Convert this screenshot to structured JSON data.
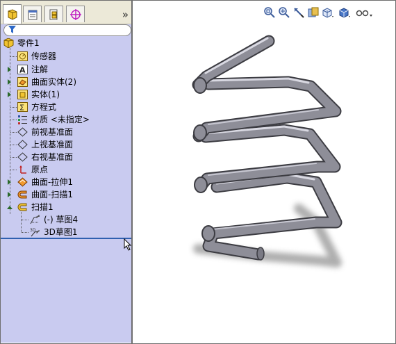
{
  "tabs": [
    {
      "name": "featuremanager-icon",
      "active": true
    },
    {
      "name": "propertymanager-icon",
      "active": false
    },
    {
      "name": "configurationmanager-icon",
      "active": false
    },
    {
      "name": "dimxpert-icon",
      "active": false
    }
  ],
  "collapse_glyph": "»",
  "tree": {
    "root": "零件1",
    "items": [
      {
        "label": "传感器",
        "icon": "sensor-icon",
        "expandable": false
      },
      {
        "label": "注解",
        "icon": "annotation-icon",
        "expandable": true
      },
      {
        "label": "曲面实体(2)",
        "icon": "surface-bodies-icon",
        "expandable": true
      },
      {
        "label": "实体(1)",
        "icon": "solid-bodies-icon",
        "expandable": true
      },
      {
        "label": "方程式",
        "icon": "equation-icon",
        "expandable": false
      },
      {
        "label": "材质 <未指定>",
        "icon": "material-icon",
        "expandable": false
      },
      {
        "label": "前视基准面",
        "icon": "plane-icon",
        "expandable": false
      },
      {
        "label": "上视基准面",
        "icon": "plane-icon",
        "expandable": false
      },
      {
        "label": "右视基准面",
        "icon": "plane-icon",
        "expandable": false
      },
      {
        "label": "原点",
        "icon": "origin-icon",
        "expandable": false
      },
      {
        "label": "曲面-拉伸1",
        "icon": "surface-extrude-icon",
        "expandable": true
      },
      {
        "label": "曲面-扫描1",
        "icon": "surface-sweep-icon",
        "expandable": true
      },
      {
        "label": "扫描1",
        "icon": "sweep-icon",
        "expandable": true,
        "open": true
      }
    ],
    "children": [
      {
        "label": "(-) 草图4",
        "icon": "sketch-icon"
      },
      {
        "label": "3D草图1",
        "icon": "3d-sketch-icon"
      }
    ]
  },
  "hud_icons": [
    "zoom-to-fit-icon",
    "zoom-to-area-icon",
    "previous-view-icon",
    "section-view-icon",
    "view-orientation-icon",
    "display-style-icon",
    "hide-show-items-icon"
  ],
  "colors": {
    "panel": "#c9cbf0",
    "tube": "#8c8c96",
    "rollback": "#3060b0"
  }
}
